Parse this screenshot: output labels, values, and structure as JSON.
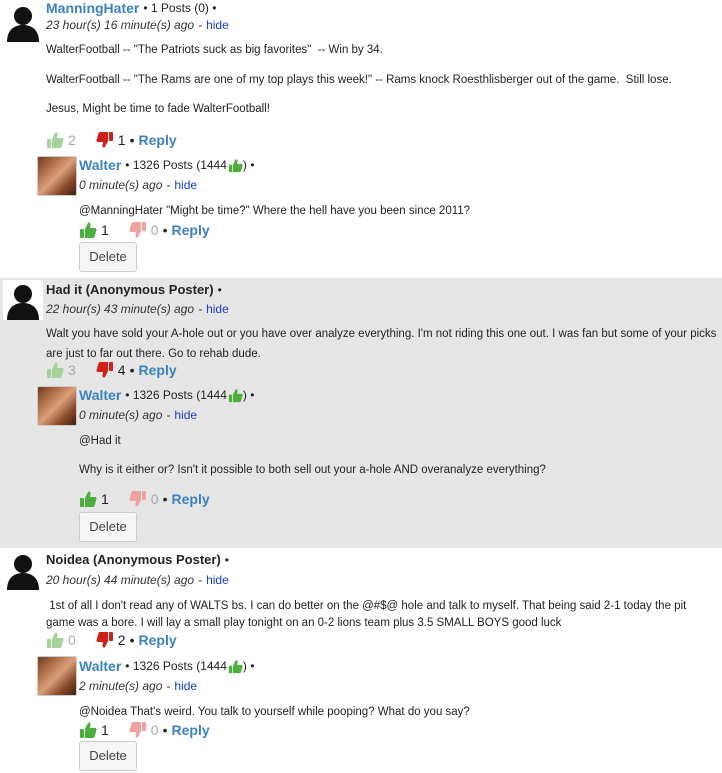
{
  "comments": [
    {
      "author": "ManningHater",
      "author_meta": "• 1 Posts (0) •",
      "time": "23 hour(s) 16 minute(s) ago",
      "hide": "hide",
      "body": [
        "WalterFootball -- \"The Patriots suck as big favorites\"  -- Win by 34.",
        "WalterFootball -- \"The Rams are one of my top plays this week!\" -- Rams knock Roesthlisberger out of the game.  Still lose.",
        "Jesus, Might be time to fade WalterFootball!"
      ],
      "up": "2",
      "down": "1",
      "reply": "Reply",
      "response": {
        "author": "Walter",
        "posts_prefix": "• 1326 Posts (1444",
        "posts_suffix": ") •",
        "time": "0 minute(s) ago",
        "hide": "hide",
        "body": [
          "@ManningHater \"Might be time?\" Where the hell have you been since 2011?"
        ],
        "up": "1",
        "down": "0",
        "reply": "Reply",
        "delete": "Delete"
      }
    },
    {
      "author": "Had it (Anonymous Poster)",
      "author_meta": "•",
      "time": "22 hour(s) 43 minute(s) ago",
      "hide": "hide",
      "body": [
        "Walt you have sold your A-hole out or you have over analyze everything. I'm not riding this one out. I was fan but some of your picks are just to far out there. Go to rehab dude."
      ],
      "up": "3",
      "down": "4",
      "reply": "Reply",
      "response": {
        "author": "Walter",
        "posts_prefix": "• 1326 Posts (1444",
        "posts_suffix": ") •",
        "time": "0 minute(s) ago",
        "hide": "hide",
        "body": [
          "@Had it",
          "Why is it either or? Isn't it possible to both sell out your a-hole AND overanalyze everything?"
        ],
        "up": "1",
        "down": "0",
        "reply": "Reply",
        "delete": "Delete"
      }
    },
    {
      "author": "Noidea (Anonymous Poster)",
      "author_meta": "•",
      "time": "20 hour(s) 44 minute(s) ago",
      "hide": "hide",
      "body": [
        " 1st of all I don't read any of WALTS bs. I can do better on the @#$@ hole and talk to myself. That being said 2-1 today the pit game was a bore. I will lay a small play tonight on an 0-2 lions team plus 3.5 SMALL BOYS good luck"
      ],
      "up": "0",
      "down": "2",
      "reply": "Reply",
      "response": {
        "author": "Walter",
        "posts_prefix": "• 1326 Posts (1444",
        "posts_suffix": ") •",
        "time": "2 minute(s) ago",
        "hide": "hide",
        "body": [
          "@Noidea That's weird. You talk to yourself while pooping? What do you say?"
        ],
        "up": "1",
        "down": "0",
        "reply": "Reply",
        "delete": "Delete"
      }
    }
  ],
  "icons": {
    "thumb_up_active": "thumbs-up-icon",
    "thumb_up_faded": "thumbs-up-faded-icon",
    "thumb_down_active": "thumbs-down-icon",
    "thumb_down_faded": "thumbs-down-faded-icon"
  },
  "colors": {
    "link": "#3c82c0",
    "hide": "#1a3ccc",
    "shade": "#e6e6e6",
    "thumb_up": "#4caf3c",
    "thumb_down": "#d0201a"
  }
}
